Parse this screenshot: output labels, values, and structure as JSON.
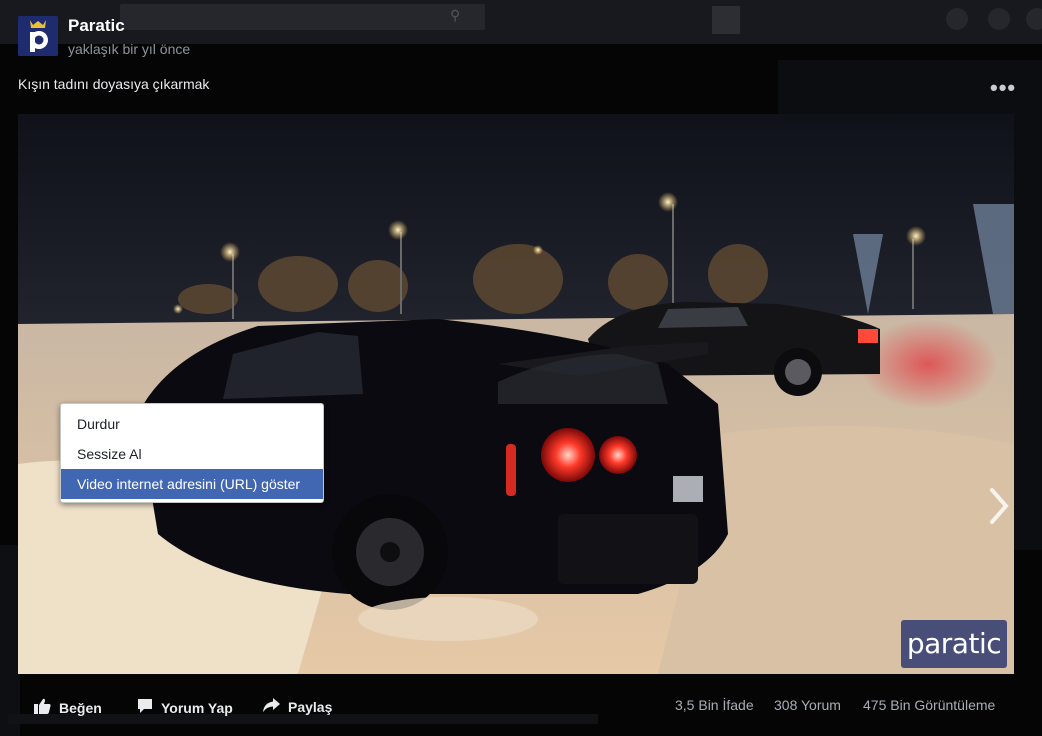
{
  "post": {
    "page_name": "Paratic",
    "time": "yaklaşık bir yıl önce",
    "caption": "Kışın tadını doyasıya çıkarmak",
    "avatar_letter": "p"
  },
  "video": {
    "watermark": "paratic"
  },
  "context_menu": {
    "items": [
      {
        "label": "Durdur"
      },
      {
        "label": "Sessize Al"
      },
      {
        "label": "Video internet adresini (URL) göster"
      }
    ]
  },
  "actions": {
    "like": "Beğen",
    "comment": "Yorum Yap",
    "share": "Paylaş"
  },
  "stats": {
    "reactions": "3,5 Bin İfade",
    "comments": "308 Yorum",
    "views": "475 Bin Görüntüleme"
  },
  "icons": {
    "more": "more-options-icon",
    "next": "chevron-right-icon",
    "like": "thumbs-up-icon",
    "comment": "comment-bubble-icon",
    "share": "share-arrow-icon"
  },
  "colors": {
    "menu_highlight": "#4267b2",
    "background": "#050505",
    "avatar": "#1e2b6e"
  }
}
